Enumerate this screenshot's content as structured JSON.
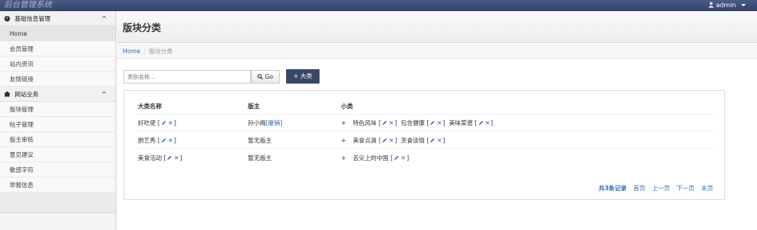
{
  "app": {
    "title": "后台管理系统",
    "user": "admin"
  },
  "sidebar": {
    "groups": [
      {
        "label": "基础信息管理",
        "toggle": "^",
        "items": [
          {
            "label": "Home"
          },
          {
            "label": "会员管理"
          },
          {
            "label": "站内资讯"
          },
          {
            "label": "友情链接"
          }
        ]
      },
      {
        "label": "网站业务",
        "toggle": "^",
        "items": [
          {
            "label": "版块管理"
          },
          {
            "label": "帖子管理"
          },
          {
            "label": "版主审核"
          },
          {
            "label": "意见建议"
          },
          {
            "label": "敏感字符"
          },
          {
            "label": "举报信息"
          }
        ]
      }
    ]
  },
  "page": {
    "title": "版块分类",
    "breadcrumb": {
      "home": "Home",
      "separator": "/",
      "current": "版块分类"
    },
    "search": {
      "placeholder": "类别名称...",
      "go_label": "Go",
      "add_label": "+ 大类"
    }
  },
  "table": {
    "headers": [
      "大类名称",
      "版主",
      "小类"
    ],
    "rows": [
      {
        "category": "好吃佬",
        "moderator": "孙小梅",
        "moderator_action": "[撤销]",
        "subs": [
          "特色风味",
          "包含健康",
          "美味菜谱"
        ]
      },
      {
        "category": "厨艺秀",
        "moderator": "暂无版主",
        "moderator_action": "",
        "subs": [
          "美食点滴",
          "烹食谈情"
        ]
      },
      {
        "category": "美食活动",
        "moderator": "暂无版主",
        "moderator_action": "",
        "subs": [
          "舌尖上的中国"
        ]
      }
    ]
  },
  "pager": {
    "total": "共3条记录",
    "first": "首页",
    "prev": "上一页",
    "next": "下一页",
    "last": "末页"
  },
  "colors": {
    "topbar": "#3b4a75",
    "link": "#2a6db3",
    "add_button": "#3a4868"
  },
  "icons": {
    "edit": "pencil-icon",
    "delete": "close-x-icon",
    "add_sub": "plus-icon"
  }
}
